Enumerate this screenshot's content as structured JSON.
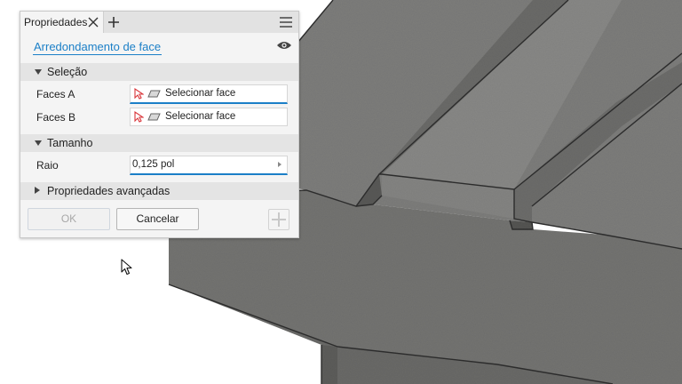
{
  "panel": {
    "tab_label": "Propriedades",
    "tab_close_icon": "close-icon",
    "tab_add_icon": "plus-icon",
    "menu_icon": "hamburger-menu-icon",
    "feature_title": "Arredondamento de face",
    "visibility_icon": "eye-icon",
    "sections": {
      "selection": {
        "title": "Seleção",
        "rows": [
          {
            "label": "Faces A",
            "value": "Selecionar face"
          },
          {
            "label": "Faces B",
            "value": "Selecionar face"
          }
        ]
      },
      "size": {
        "title": "Tamanho",
        "radius_label": "Raio",
        "radius_value": "0,125 pol"
      },
      "advanced": {
        "title": "Propriedades avançadas"
      }
    },
    "buttons": {
      "ok": "OK",
      "cancel": "Cancelar",
      "add_icon": "plus-icon"
    }
  },
  "colors": {
    "accent": "#1b7fc7",
    "panel_bg": "#f4f4f4",
    "section_bg": "#e4e4e4",
    "model_grey": "#7a7a78",
    "selection_arrow": "#d9353a"
  }
}
